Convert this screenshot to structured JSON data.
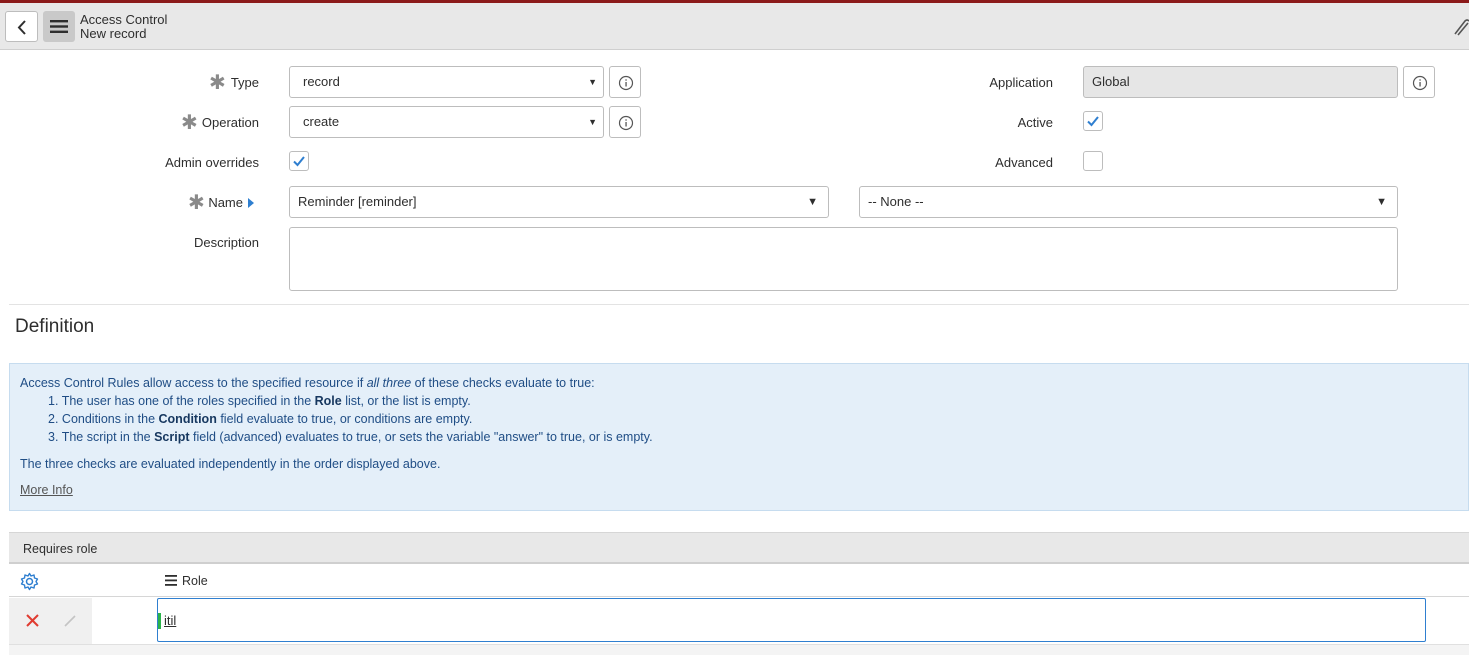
{
  "header": {
    "title": "Access Control",
    "subtitle": "New record"
  },
  "form": {
    "type": {
      "label": "Type",
      "value": "record"
    },
    "operation": {
      "label": "Operation",
      "value": "create"
    },
    "admin_overrides": {
      "label": "Admin overrides",
      "checked": true
    },
    "name": {
      "label": "Name",
      "value": "Reminder [reminder]",
      "field_value": "-- None --"
    },
    "description": {
      "label": "Description",
      "value": ""
    },
    "application": {
      "label": "Application",
      "value": "Global"
    },
    "active": {
      "label": "Active",
      "checked": true
    },
    "advanced": {
      "label": "Advanced",
      "checked": false
    }
  },
  "definition": {
    "heading": "Definition",
    "intro_prefix": "Access Control Rules allow access to the specified resource if ",
    "intro_em": "all three",
    "intro_suffix": " of these checks evaluate to true:",
    "items": [
      {
        "num": "1.",
        "pre": "The user has one of the roles specified in the ",
        "bold": "Role",
        "post": " list, or the list is empty."
      },
      {
        "num": "2.",
        "pre": "Conditions in the ",
        "bold": "Condition",
        "post": " field evaluate to true, or conditions are empty."
      },
      {
        "num": "3.",
        "pre": "The script in the ",
        "bold": "Script",
        "post": " field (advanced) evaluates to true, or sets the variable \"answer\" to true, or is empty."
      }
    ],
    "note": "The three checks are evaluated independently in the order displayed above.",
    "more_info": "More Info"
  },
  "related_list": {
    "title": "Requires role",
    "column": "Role",
    "rows": [
      {
        "role": "itil"
      }
    ]
  },
  "colors": {
    "accent_line": "#8b1a1a",
    "check_blue": "#2f7fd0",
    "delete_red": "#e03c31",
    "info_bg": "#e4eff9",
    "info_text": "#1f4d85",
    "cursor_green": "#2bb34a"
  }
}
